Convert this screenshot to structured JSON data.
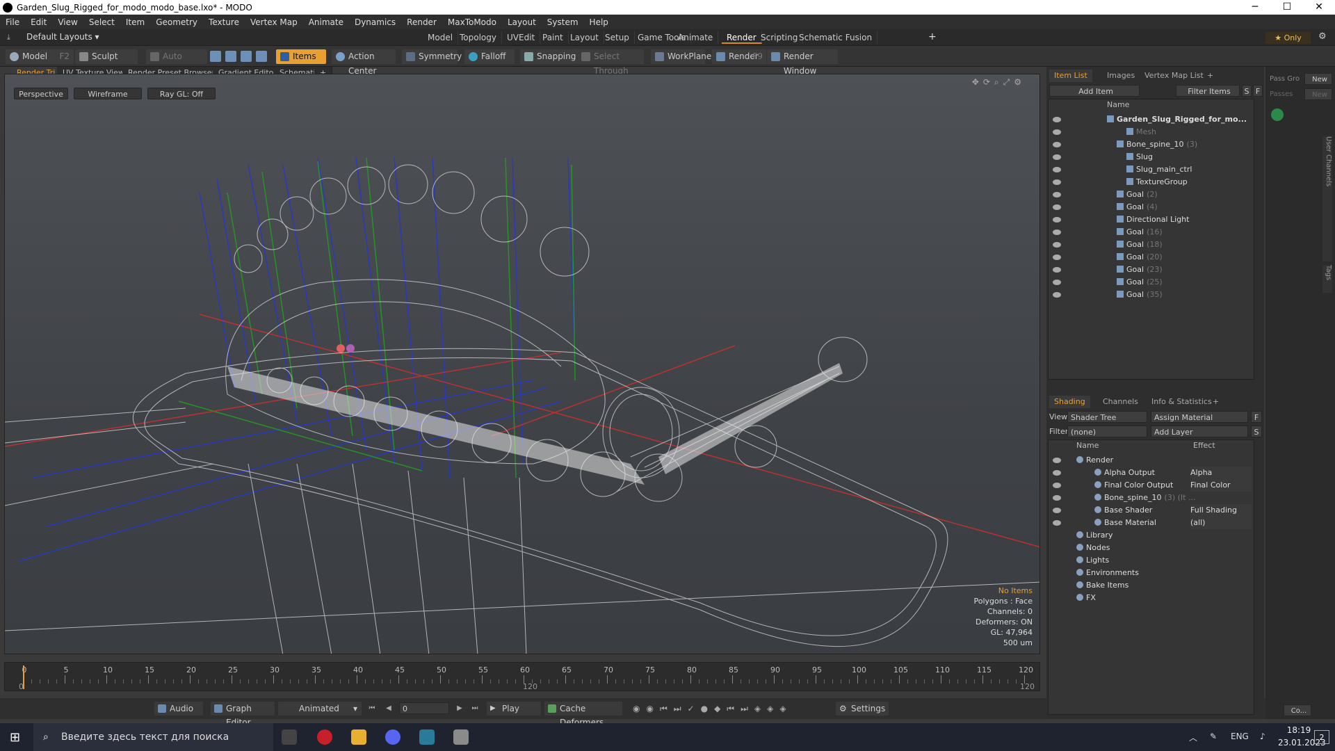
{
  "window": {
    "title": "Garden_Slug_Rigged_for_modo_modo_base.lxo* - MODO",
    "min": "─",
    "max": "☐",
    "close": "✕"
  },
  "menu": [
    "File",
    "Edit",
    "View",
    "Select",
    "Item",
    "Geometry",
    "Texture",
    "Vertex Map",
    "Animate",
    "Dynamics",
    "Render",
    "MaxToModo",
    "Layout",
    "System",
    "Help"
  ],
  "layoutbar": {
    "layouts": "Default Layouts ▾",
    "tabs": [
      "Model",
      "Topology",
      "UVEdit",
      "Paint",
      "Layout",
      "Setup",
      "Game Tools",
      "Animate",
      "Render",
      "Scripting",
      "Schematic Fusion"
    ],
    "add": "+",
    "only": "★ Only",
    "gear": "⚙"
  },
  "toolbar": {
    "model": "Model",
    "model_key": "F2",
    "sculpt": "Sculpt",
    "auto_select": "Auto Select",
    "items": "Items",
    "action_center": "Action Center",
    "symmetry": "Symmetry",
    "falloff": "Falloff",
    "snapping": "Snapping",
    "select_through": "Select Through",
    "workplane": "WorkPlane",
    "render": "Render",
    "render_key": "F9",
    "render_window": "Render Window"
  },
  "viewport_tabs": [
    "Render Tri",
    "UV Texture View",
    "Render Preset Browser",
    "Gradient Editor",
    "Schematic",
    "+"
  ],
  "viewport": {
    "perspective": "Perspective",
    "wireframe": "Wireframe",
    "raygl": "Ray GL: Off",
    "stats": [
      "No Items",
      "Polygons : Face",
      "Channels: 0",
      "Deformers: ON",
      "GL: 47,964",
      "500 um"
    ]
  },
  "timeline": {
    "ticks": [
      "0",
      "5",
      "10",
      "15",
      "20",
      "25",
      "30",
      "35",
      "40",
      "45",
      "50",
      "55",
      "60",
      "65",
      "70",
      "75",
      "80",
      "85",
      "90",
      "95",
      "100",
      "105",
      "110",
      "115",
      "120"
    ],
    "start": "0",
    "mid": "120",
    "end": "120"
  },
  "transport": {
    "audio": "Audio",
    "graph_editor": "Graph Editor",
    "animated": "Animated",
    "frame": "0",
    "play": "Play",
    "cache_deformers": "Cache Deformers",
    "settings": "Settings"
  },
  "itemlist": {
    "tabs": [
      "Item List",
      "Images",
      "Vertex Map List",
      "+"
    ],
    "add_item": "Add Item",
    "filter_items": "Filter Items",
    "s": "S",
    "f": "F",
    "col_name": "Name",
    "rows": [
      {
        "name": "Garden_Slug_Rigged_for_mo...",
        "cnt": "",
        "indent": 0,
        "bold": true
      },
      {
        "name": "Mesh",
        "cnt": "",
        "indent": 2,
        "dim": true
      },
      {
        "name": "Bone_spine_10",
        "cnt": "(3)",
        "indent": 1
      },
      {
        "name": "Slug",
        "cnt": "",
        "indent": 2
      },
      {
        "name": "Slug_main_ctrl",
        "cnt": "",
        "indent": 2
      },
      {
        "name": "TextureGroup",
        "cnt": "",
        "indent": 2
      },
      {
        "name": "Goal",
        "cnt": "(2)",
        "indent": 1
      },
      {
        "name": "Goal",
        "cnt": "(4)",
        "indent": 1
      },
      {
        "name": "Directional Light",
        "cnt": "",
        "indent": 1
      },
      {
        "name": "Goal",
        "cnt": "(16)",
        "indent": 1
      },
      {
        "name": "Goal",
        "cnt": "(18)",
        "indent": 1
      },
      {
        "name": "Goal",
        "cnt": "(20)",
        "indent": 1
      },
      {
        "name": "Goal",
        "cnt": "(23)",
        "indent": 1
      },
      {
        "name": "Goal",
        "cnt": "(25)",
        "indent": 1
      },
      {
        "name": "Goal",
        "cnt": "(35)",
        "indent": 1
      }
    ]
  },
  "shading": {
    "tabs": [
      "Shading",
      "Channels",
      "Info & Statistics",
      "+"
    ],
    "view_label": "View",
    "view_value": "Shader Tree",
    "assign_material": "Assign Material",
    "filter_label": "Filter",
    "filter_value": "(none)",
    "add_layer": "Add Layer",
    "f": "F",
    "s": "S",
    "col_name": "Name",
    "col_effect": "Effect",
    "rows": [
      {
        "name": "Render",
        "effect": "",
        "indent": 0
      },
      {
        "name": "Alpha Output",
        "effect": "Alpha",
        "indent": 1
      },
      {
        "name": "Final Color Output",
        "effect": "Final Color",
        "indent": 1
      },
      {
        "name": "Bone_spine_10",
        "cnt": "(3) (It ...",
        "effect": "",
        "indent": 1
      },
      {
        "name": "Base Shader",
        "effect": "Full Shading",
        "indent": 1
      },
      {
        "name": "Base Material",
        "effect": "(all)",
        "indent": 1
      },
      {
        "name": "Library",
        "effect": "",
        "indent": 0
      },
      {
        "name": "Nodes",
        "effect": "",
        "indent": 0
      },
      {
        "name": "Lights",
        "effect": "",
        "indent": 0
      },
      {
        "name": "Environments",
        "effect": "",
        "indent": 0
      },
      {
        "name": "Bake Items",
        "effect": "",
        "indent": 0
      },
      {
        "name": "FX",
        "effect": "",
        "indent": 0
      }
    ]
  },
  "farright": {
    "pass_gro": "Pass Gro",
    "new1": "New",
    "passes": "Passes",
    "new2": "New",
    "user_channels": "User Channels",
    "tags": "Tags",
    "co": "Co..."
  },
  "taskbar": {
    "search": "Введите здесь текст для поиска",
    "lang": "ENG",
    "time": "18:19",
    "date": "23.01.2023",
    "notif": "2"
  }
}
